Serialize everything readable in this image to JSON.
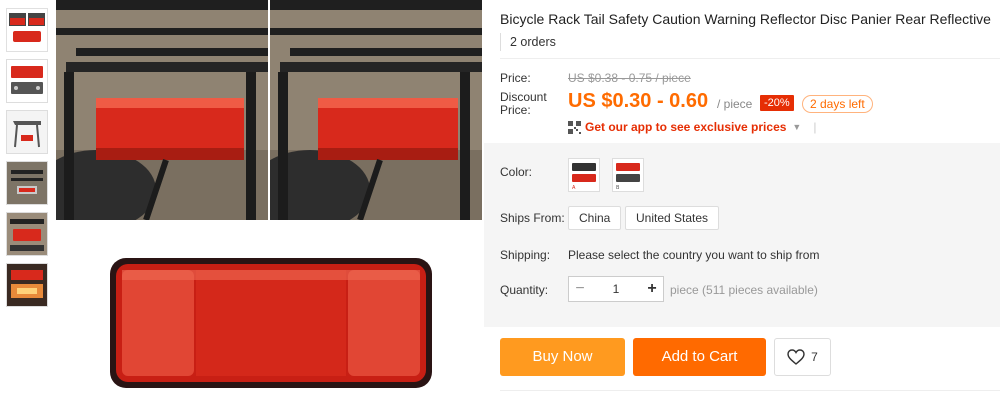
{
  "product": {
    "title": "Bicycle Rack Tail Safety Caution Warning Reflector Disc Panier Rear Reflective",
    "orders": "2 orders"
  },
  "price": {
    "price_label": "Price:",
    "original": "US $0.38 - 0.75 / piece",
    "discount_label": "Discount Price:",
    "discount_price": "US $0.30 - 0.60",
    "per_piece": "/ piece",
    "discount_pct": "-20%",
    "days_left": "2 days left",
    "app_promo": "Get our app to see exclusive prices"
  },
  "options": {
    "color_label": "Color:",
    "color_swatches": [
      "A",
      "B"
    ],
    "ships_from_label": "Ships From:",
    "ships_from": [
      "China",
      "United States"
    ],
    "shipping_label": "Shipping:",
    "shipping_text": "Please select the country you want to ship from",
    "quantity_label": "Quantity:",
    "quantity_value": "1",
    "minus": "−",
    "plus": "+",
    "quantity_note": "piece (511 pieces available)"
  },
  "actions": {
    "buy_now": "Buy Now",
    "add_to_cart": "Add to Cart",
    "wishlist_count": "7"
  },
  "colors": {
    "accent": "#ff6a00",
    "buy_now": "#ff9a1f",
    "discount_red": "#e62e04",
    "reflector_red": "#d8291c"
  }
}
